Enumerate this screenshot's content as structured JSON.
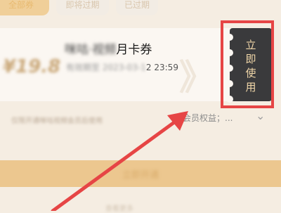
{
  "tabs": [
    {
      "label": "全部券",
      "active": true
    },
    {
      "label": "即将过期",
      "active": false
    },
    {
      "label": "已过期",
      "active": false
    }
  ],
  "coupon": {
    "price": "¥19.8",
    "title_blurred": "咪咕·视频",
    "title_visible": "月卡券",
    "date_blurred": "有效期至 2023-03-1",
    "date_visible": "2 23:59",
    "watermark": "》"
  },
  "use_button": {
    "label": "立\n即\n使\n用"
  },
  "rights": {
    "blurred_text": "仅限开通咪咕视频会员后使用",
    "visible_text": "会员权益；...",
    "chevron": "⌄"
  },
  "big_button": {
    "label": "立即开通"
  },
  "bottom": {
    "blurred_text": "查看更多"
  },
  "colors": {
    "highlight": "#e64545",
    "button_bg": "#3a3a3c",
    "button_text": "#f1d7a9",
    "accent": "#ecc78f"
  }
}
